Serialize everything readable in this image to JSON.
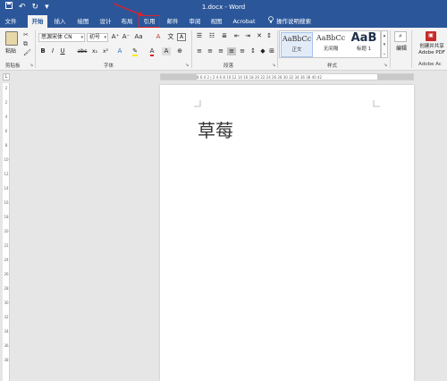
{
  "window": {
    "title": "1.docx - Word"
  },
  "quick_access": {
    "save_icon": "save-icon",
    "undo": "↶",
    "redo": "↻",
    "customize": "▾"
  },
  "tabs": [
    {
      "label": "文件"
    },
    {
      "label": "开始"
    },
    {
      "label": "插入"
    },
    {
      "label": "绘图"
    },
    {
      "label": "设计"
    },
    {
      "label": "布局"
    },
    {
      "label": "引用"
    },
    {
      "label": "邮件"
    },
    {
      "label": "审阅"
    },
    {
      "label": "视图"
    },
    {
      "label": "Acrobat"
    }
  ],
  "tell_me": {
    "placeholder": "操作说明搜索"
  },
  "ribbon": {
    "clipboard": {
      "paste": "粘贴",
      "label": "剪贴板"
    },
    "font": {
      "label": "字体",
      "font_name": "思源宋体 CN",
      "font_size": "初号",
      "bold": "B",
      "italic": "I",
      "underline": "U",
      "strike": "abc",
      "subscript": "x₂",
      "superscript": "x²",
      "grow": "A⁺",
      "shrink": "A⁻",
      "case": "Aa",
      "clear": "A",
      "highlight": "A",
      "color": "A"
    },
    "paragraph": {
      "label": "段落"
    },
    "styles": {
      "label": "样式",
      "items": [
        {
          "sample": "AaBbCc",
          "name": "正文"
        },
        {
          "sample": "AaBbCc",
          "name": "无间隔"
        },
        {
          "sample": "AaB",
          "name": "标题 1"
        }
      ]
    },
    "editing": {
      "label": "编辑"
    },
    "adobe": {
      "line1": "创建并共享",
      "line2": "Adobe PDF",
      "label": "Adobe Ac"
    }
  },
  "ruler": {
    "h_ticks": "8  6  4  2  |  2  4  6  8  10  12  14  16  18  20  22  24  26  28  30  32  34  36  38  40  42",
    "v_ticks": [
      "2",
      "2",
      "4",
      "6",
      "8",
      "10",
      "12",
      "14",
      "16",
      "18",
      "20",
      "22",
      "24",
      "26",
      "28",
      "30",
      "32",
      "34",
      "36",
      "38"
    ]
  },
  "document": {
    "text": "草莓"
  },
  "colors": {
    "title_bar": "#2b579a",
    "highlight_box": "#e0202a"
  }
}
